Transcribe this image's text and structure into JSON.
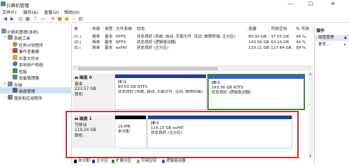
{
  "window": {
    "title": "计算机管理",
    "minimize": "—",
    "maximize": "☐",
    "close": "✕"
  },
  "menu": [
    "文件(F)",
    "操作(A)",
    "查看(V)",
    "帮助(H)"
  ],
  "sidebar": {
    "root": "计算机管理(本地)",
    "items": [
      {
        "label": "系统工具",
        "icon": "tools-icon"
      },
      {
        "label": "任务计划程序",
        "icon": "clock-icon"
      },
      {
        "label": "事件查看器",
        "icon": "event-viewer-icon"
      },
      {
        "label": "共享文件夹",
        "icon": "shared-folder-icon"
      },
      {
        "label": "本地用户和组",
        "icon": "users-icon"
      },
      {
        "label": "性能",
        "icon": "performance-icon"
      },
      {
        "label": "设备管理器",
        "icon": "device-manager-icon"
      },
      {
        "label": "存储",
        "icon": "storage-icon"
      },
      {
        "label": "磁盘管理",
        "icon": "disk-icon"
      },
      {
        "label": "服务和应用程序",
        "icon": "services-icon"
      }
    ]
  },
  "table": {
    "headers": [
      "卷",
      "布局",
      "类型",
      "文件系统",
      "状态",
      "容量",
      "可用空间",
      "% 可用"
    ],
    "rows": [
      [
        "(C:)",
        "简单",
        "基本",
        "NTFS",
        "状态良好 (系统, 启动, 页面文件, 活动, 故障转储, 主分区)",
        "80.00 GB",
        "37.05 GB",
        "46 %"
      ],
      [
        "(D:)",
        "简单",
        "基本",
        "NTFS",
        "状态良好 (逻辑驱动器)",
        "143.56 GB",
        "63.24 GB",
        "44 %"
      ],
      [
        "(E:)",
        "简单",
        "基本",
        "exFAT",
        "状态良好 (主分区)",
        "119.21 GB",
        "117.84 GB",
        "99 %"
      ]
    ]
  },
  "actions": {
    "header": "操作",
    "items": [
      "磁盘管理",
      "更多..."
    ]
  },
  "disks": [
    {
      "name": "磁盘 0",
      "type": "基本",
      "size": "223.57 GB",
      "status": "联机",
      "volumes": [
        {
          "name": "(C:)",
          "size": "80.00 GB NTFS",
          "status": "状态良好 (系统, 启动, 页面文件, 活动, 故障转储)"
        },
        {
          "name": "(D:)",
          "size": "143.56 GB NTFS",
          "status": "状态良好 (逻辑驱动器)"
        }
      ]
    },
    {
      "name": "磁盘 1",
      "type": "可移动",
      "size": "119.24 GB",
      "status": "联机",
      "volumes": [
        {
          "name": "",
          "size": "16 MB",
          "status": "未分配"
        },
        {
          "name": "(E:)",
          "size": "119.23 GB exFAT",
          "status": "状态良好 (主分区)"
        }
      ]
    }
  ],
  "legend": [
    "未分配",
    "主分区",
    "扩展分区",
    "可用空间",
    "逻辑驱动器"
  ],
  "colors": {
    "primary": "#1f3fa0",
    "unallocated": "#000000",
    "extended": "#2e8b2e",
    "free": "#79c267",
    "logical": "#3b5fd6",
    "highlight_red": "#d03030",
    "highlight_green": "#2f8f2f"
  }
}
